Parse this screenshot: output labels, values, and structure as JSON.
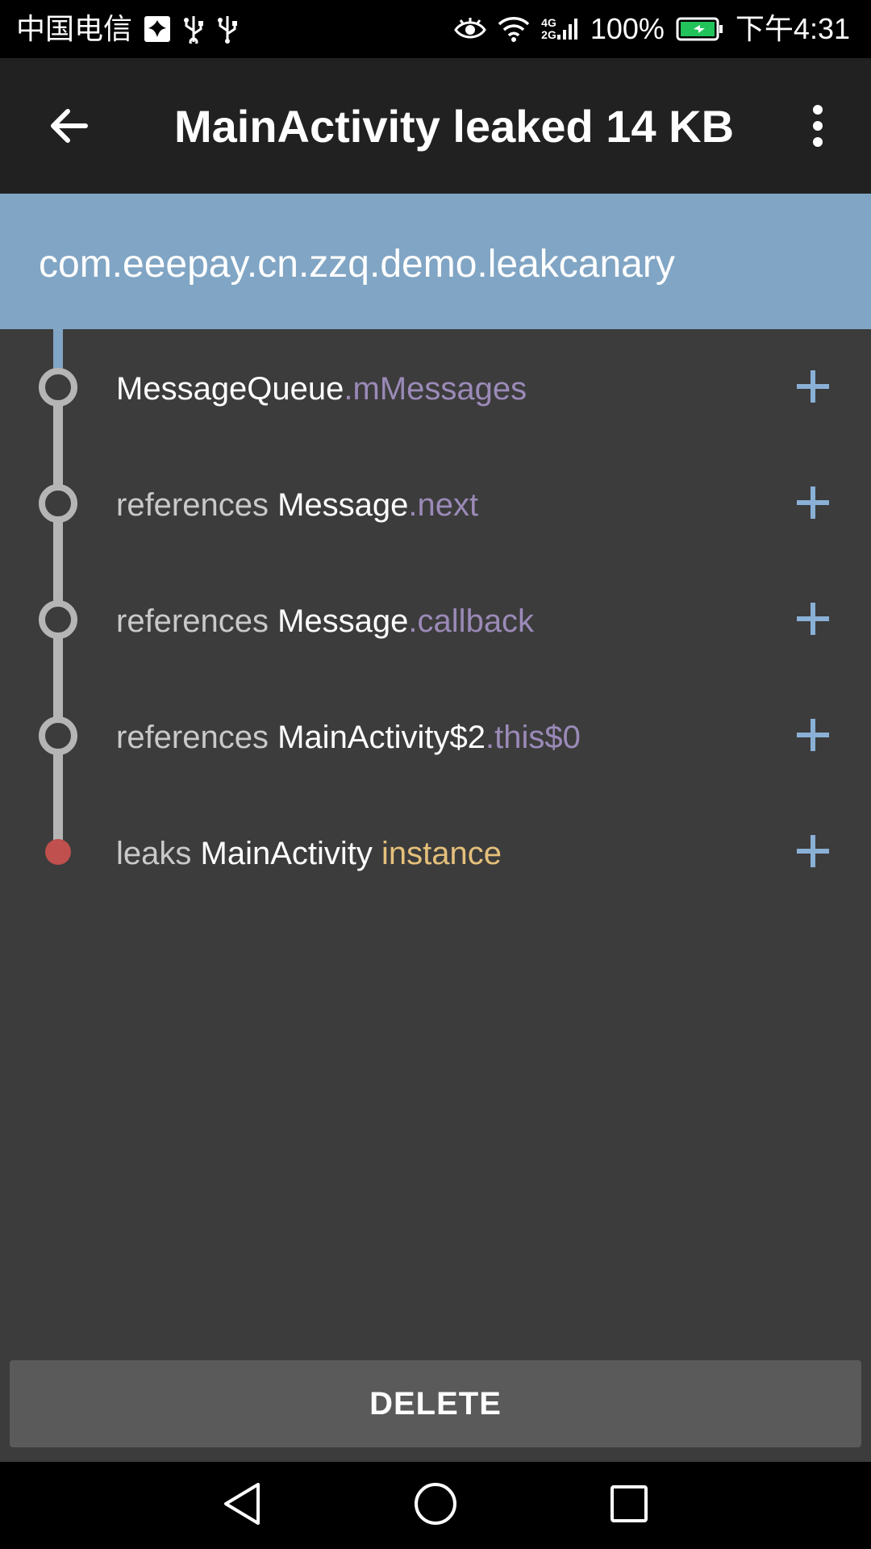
{
  "status_bar": {
    "carrier": "中国电信",
    "network": [
      "4G",
      "2G"
    ],
    "battery_percent": "100%",
    "time": "下午4:31",
    "icons": [
      "huawei-icon",
      "usb-icon",
      "usb-icon",
      "eye-icon",
      "wifi-icon",
      "signal-icon",
      "battery-icon"
    ],
    "battery_color": "#21c35a"
  },
  "app_bar": {
    "title": "MainActivity leaked 14 KB",
    "back_icon": "arrow-back-icon",
    "menu_icon": "more-vert-icon"
  },
  "header": {
    "package": "com.eeepay.cn.zzq.demo.leakcanary",
    "color": "#81a5c4"
  },
  "trace": [
    {
      "prefix": "",
      "class": "MessageQueue",
      "sep": ".",
      "field": "mMessages",
      "type": "field"
    },
    {
      "prefix": "references ",
      "class": "Message",
      "sep": ".",
      "field": "next",
      "type": "field"
    },
    {
      "prefix": "references ",
      "class": "Message",
      "sep": ".",
      "field": "callback",
      "type": "field"
    },
    {
      "prefix": "references ",
      "class": "MainActivity$2",
      "sep": ".",
      "field": "this$0",
      "type": "field"
    },
    {
      "prefix": "leaks ",
      "class": "MainActivity",
      "sep": " ",
      "field": "instance",
      "type": "leak"
    }
  ],
  "colors": {
    "field": "#9b8ab8",
    "instance": "#e5c07b",
    "leak_node": "#c0504d",
    "plus": "#8ab0d6"
  },
  "delete_label": "DELETE",
  "nav_bar": [
    "back-triangle-icon",
    "home-circle-icon",
    "recents-square-icon"
  ]
}
